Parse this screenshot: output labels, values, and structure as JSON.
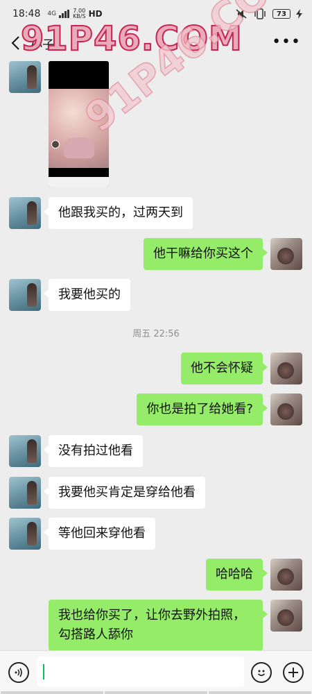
{
  "status_bar": {
    "time": "18:48",
    "network": "4G",
    "speed_value": "7.00",
    "speed_unit": "KB/S",
    "hd": "HD",
    "battery": "73"
  },
  "header": {
    "title": "小子"
  },
  "watermark": {
    "top": "91P46.COM",
    "diagonal": "91P46.COM"
  },
  "messages": [
    {
      "side": "left",
      "type": "image",
      "icon": "video-thumbnail"
    },
    {
      "side": "left",
      "text": "他跟我买的，过两天到"
    },
    {
      "side": "right",
      "text": "他干嘛给你买这个"
    },
    {
      "side": "left",
      "text": "我要他买的"
    },
    {
      "side": "right",
      "text": "他不会怀疑"
    },
    {
      "side": "right",
      "text": "你也是拍了给她看?"
    },
    {
      "side": "left",
      "text": "没有拍过他看"
    },
    {
      "side": "left",
      "text": "我要他买肯定是穿给他看"
    },
    {
      "side": "left",
      "text": "等他回来穿他看"
    },
    {
      "side": "right",
      "text": "哈哈哈"
    },
    {
      "side": "right",
      "lines": [
        "我也给你买了，让你去野外拍照，",
        "勾搭路人舔你"
      ]
    }
  ],
  "timestamp": "周五 22:56",
  "input": {
    "value": "",
    "voice_icon": "voice-icon",
    "emoji_icon": "emoji-icon",
    "plus_icon": "plus-icon"
  },
  "colors": {
    "background": "#ededed",
    "sent_bubble": "#95ec69",
    "received_bubble": "#ffffff",
    "caret": "#07c160"
  }
}
